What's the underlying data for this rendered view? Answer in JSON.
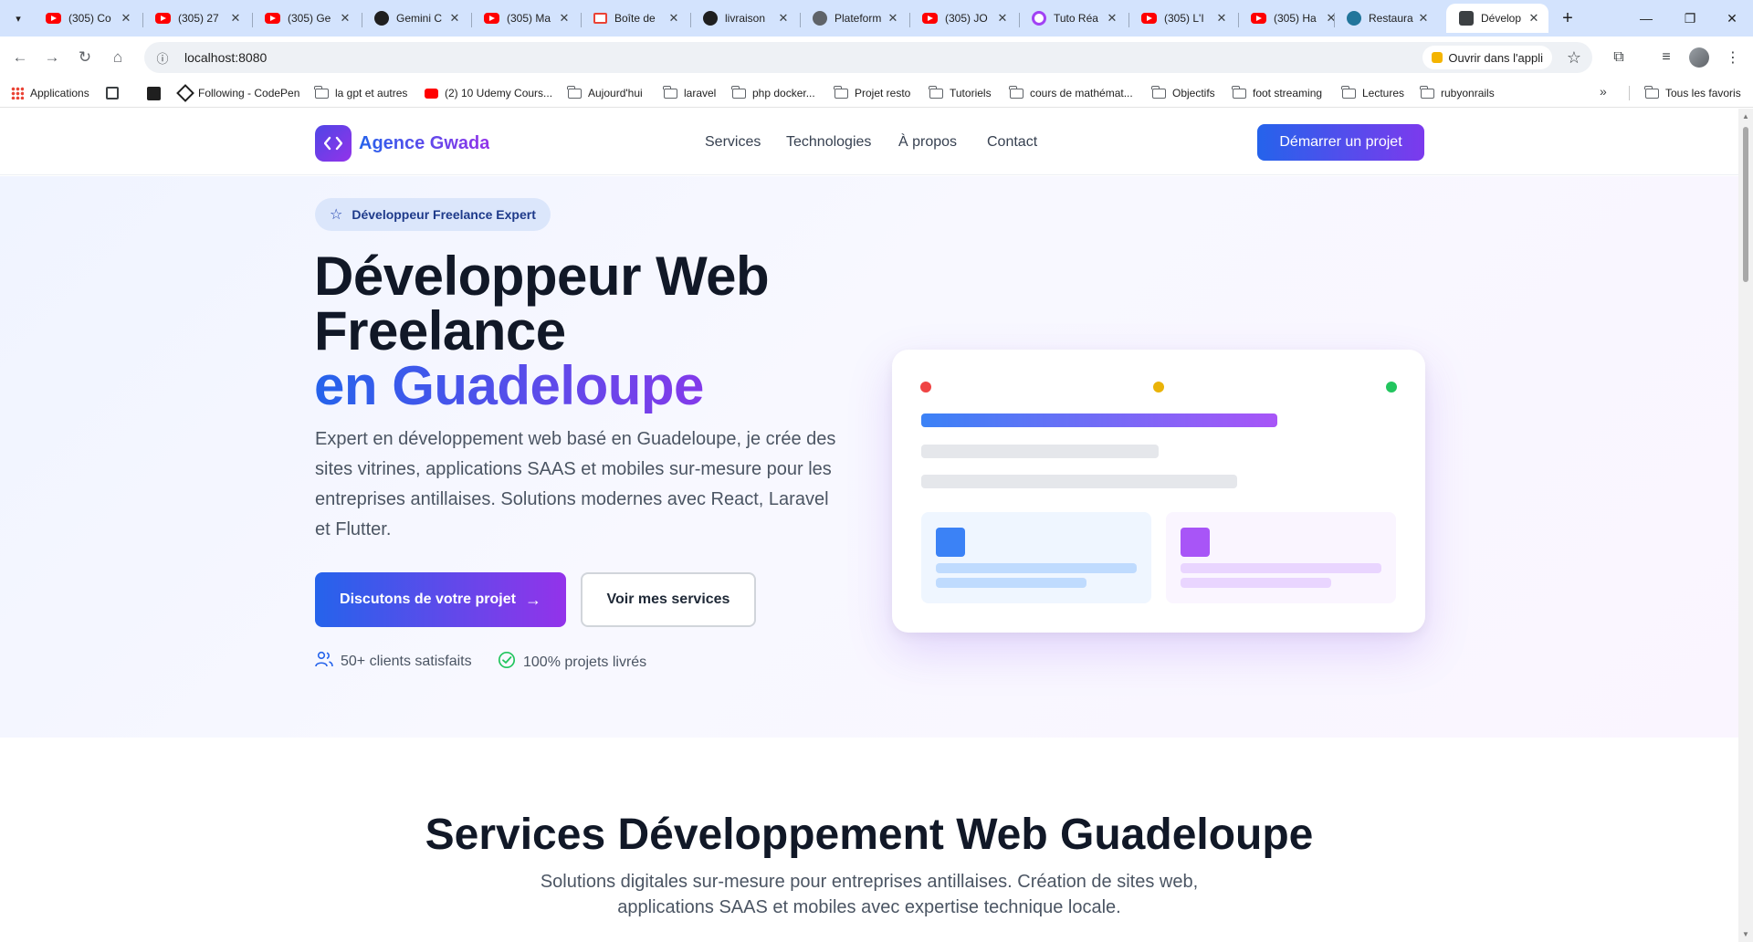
{
  "browser": {
    "tabs": [
      {
        "title": "(305) Co",
        "favicon": "youtube-icon"
      },
      {
        "title": "(305) 27",
        "favicon": "youtube-icon"
      },
      {
        "title": "(305) Ge",
        "favicon": "youtube-icon"
      },
      {
        "title": "Gemini C",
        "favicon": "gemini-icon"
      },
      {
        "title": "(305) Ma",
        "favicon": "youtube-icon"
      },
      {
        "title": "Boîte de",
        "favicon": "gmail-icon"
      },
      {
        "title": "livraison",
        "favicon": "app-icon"
      },
      {
        "title": "Plateform",
        "favicon": "globe-icon"
      },
      {
        "title": "(305) JO",
        "favicon": "youtube-icon"
      },
      {
        "title": "Tuto Réa",
        "favicon": "tuto-icon"
      },
      {
        "title": "(305) L'I",
        "favicon": "youtube-icon"
      },
      {
        "title": "(305) Ha",
        "favicon": "youtube-icon"
      },
      {
        "title": "Restaura",
        "favicon": "wordpress-icon"
      },
      {
        "title": "Dévelop",
        "favicon": "page-icon",
        "active": true
      }
    ],
    "url": "localhost:8080",
    "open_in_app_label": "Ouvrir dans l'appli",
    "bookmarks": [
      {
        "label": "Applications",
        "icon": "apps-icon"
      },
      {
        "label": "",
        "icon": "grid-icon"
      },
      {
        "label": "",
        "icon": "black-app-icon"
      },
      {
        "label": "Following - CodePen",
        "icon": "codepen-icon"
      },
      {
        "label": "la gpt et autres",
        "icon": "folder-icon"
      },
      {
        "label": "(2) 10 Udemy Cours...",
        "icon": "youtube-icon"
      },
      {
        "label": "Aujourd'hui",
        "icon": "folder-icon"
      },
      {
        "label": "laravel",
        "icon": "folder-icon"
      },
      {
        "label": "php docker...",
        "icon": "folder-icon"
      },
      {
        "label": "Projet resto",
        "icon": "folder-icon"
      },
      {
        "label": "Tutoriels",
        "icon": "folder-icon"
      },
      {
        "label": "cours de mathémat...",
        "icon": "folder-icon"
      },
      {
        "label": "Objectifs",
        "icon": "folder-icon"
      },
      {
        "label": "foot streaming",
        "icon": "folder-icon"
      },
      {
        "label": "Lectures",
        "icon": "folder-icon"
      },
      {
        "label": "rubyonrails",
        "icon": "folder-icon"
      }
    ],
    "all_bookmarks_label": "Tous les favoris"
  },
  "site": {
    "logo_text": "Agence Gwada",
    "nav": [
      "Services",
      "Technologies",
      "À propos",
      "Contact"
    ],
    "cta_header": "Démarrer un projet"
  },
  "hero": {
    "badge": "Développeur Freelance Expert",
    "title_line1": "Développeur Web",
    "title_line2": "Freelance",
    "title_line3": "en Guadeloupe",
    "description": "Expert en développement web basé en Guadeloupe, je crée des sites vitrines, applications SAAS et mobiles sur-mesure pour les entreprises antillaises. Solutions modernes avec React, Laravel et Flutter.",
    "primary_button": "Discutons de votre projet",
    "secondary_button": "Voir mes services",
    "stats": [
      "50+ clients satisfaits",
      "100% projets livrés"
    ]
  },
  "services": {
    "title": "Services Développement Web Guadeloupe",
    "subtitle": "Solutions digitales sur-mesure pour entreprises antillaises. Création de sites web, applications SAAS et mobiles avec expertise technique locale."
  },
  "colors": {
    "brand_blue": "#2563eb",
    "brand_purple": "#9333ea",
    "dot_red": "#ef4444",
    "dot_yellow": "#eab308",
    "dot_green": "#22c55e"
  }
}
